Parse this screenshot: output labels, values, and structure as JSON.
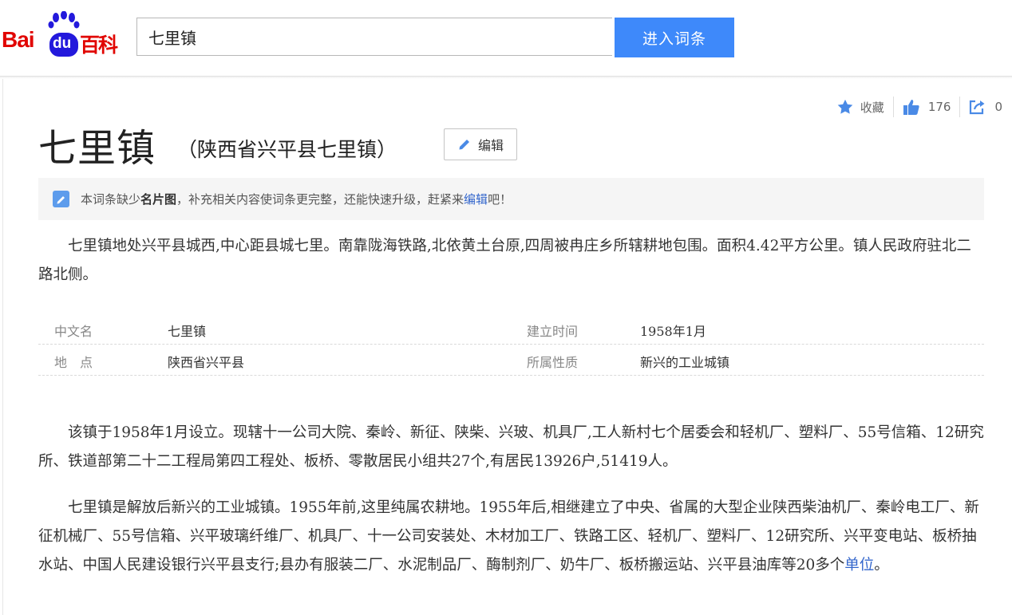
{
  "header": {
    "logo": {
      "bai": "Bai",
      "du": "du",
      "baike": "百科"
    },
    "search": {
      "value": "七里镇"
    },
    "search_button": "进入词条"
  },
  "actions": {
    "favorite_label": "收藏",
    "like_count": "176",
    "share_count": "0"
  },
  "entry": {
    "title": "七里镇",
    "subtitle": "（陕西省兴平县七里镇）",
    "edit_label": "编辑"
  },
  "notice": {
    "text_before": "本词条缺少",
    "bold": "名片图",
    "text_middle": "，补充相关内容使词条更完整，还能快速升级，赶紧来",
    "link": "编辑",
    "text_after": "吧！"
  },
  "summary": "七里镇地处兴平县城西,中心距县城七里。南靠陇海铁路,北依黄土台原,四周被冉庄乡所辖耕地包围。面积4.42平方公里。镇人民政府驻北二路北侧。",
  "basic_info": [
    {
      "k1": "中文名",
      "v1": "七里镇",
      "k2": "建立时间",
      "v2": "1958年1月"
    },
    {
      "k1": "地　点",
      "v1": "陕西省兴平县",
      "k2": "所属性质",
      "v2": "新兴的工业城镇"
    }
  ],
  "paragraphs": {
    "p1": "该镇于1958年1月设立。现辖十一公司大院、秦岭、新征、陕柴、兴玻、机具厂,工人新村七个居委会和轻机厂、塑料厂、55号信箱、12研究所、铁道部第二十二工程局第四工程处、板桥、零散居民小组共27个,有居民13926户,51419人。",
    "p2_text": "七里镇是解放后新兴的工业城镇。1955年前,这里纯属农耕地。1955年后,相继建立了中央、省属的大型企业陕西柴油机厂、秦岭电工厂、新征机械厂、55号信箱、兴平玻璃纤维厂、机具厂、十一公司安装处、木材加工厂、铁路工区、轻机厂、塑料厂、12研究所、兴平变电站、板桥抽水站、中国人民建设银行兴平县支行;县办有服装二厂、水泥制品厂、酶制剂厂、奶牛厂、板桥搬运站、兴平县油库等20多个",
    "p2_link": "单位",
    "p2_end": "。"
  },
  "colors": {
    "brand_red": "#e10602",
    "brand_blue": "#2319dc",
    "button_blue": "#3e89fa",
    "link": "#3366cc"
  }
}
